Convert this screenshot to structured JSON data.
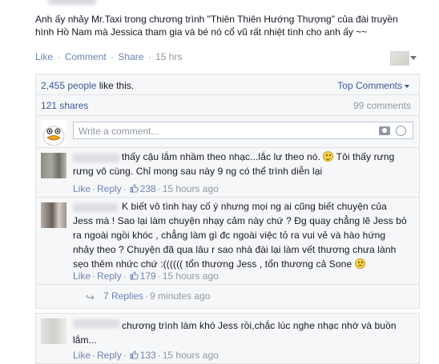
{
  "post": {
    "text_line1": "Anh ấy nhảy Mr.Taxi trong chương trình \"Thiên Thiên Hướng Thượng\" của đài truyền",
    "text_line2": "hình Hồ Nam mà Jessica tham gia và bé nó cổ vũ rất nhiệt tình cho anh ấy ~~",
    "actions": {
      "like": "Like",
      "comment": "Comment",
      "share": "Share",
      "time": "15 hrs"
    }
  },
  "summary": {
    "likes_count": "2,455 people",
    "likes_suffix": "like this.",
    "top_comments": "Top Comments",
    "shares": "121 shares",
    "comments": "99 comments"
  },
  "composer": {
    "placeholder": "Write a comment..."
  },
  "comments": [
    {
      "lines": [
        "thấy cậu lắm nhầm theo nhạc...lắc lư theo nó.",
        "rưng vô cùng. Chỉ mong sau này 9 ng có thể trình diễn lại"
      ],
      "line1_tail": "Tôi thấy rưng",
      "like": "Like",
      "reply": "Reply",
      "likes": "238",
      "time": "15 hours ago"
    },
    {
      "lines": [
        "K biết vô tình hay cố ý nhưng mọi ng ai cũng biết chuyện của",
        "Jess mà ! Sao lại làm chuyện nhạy cảm này chứ ? Đg quay chẳng lẽ Jess bỏ",
        "ra ngoài ngồi khóc , chẳng làm gì đc ngoài việc tỏ ra vui vẻ và hào hứng",
        "nhảy theo ? Chuyện đã qua lâu r sao nhà đài lại làm vết thương chưa lành",
        "sẹo thêm nhức chứ :(((((( tổn thương Jess , tổn thương cả Sone"
      ],
      "like": "Like",
      "reply": "Reply",
      "likes": "179",
      "time": "15 hours ago"
    },
    {
      "lines": [
        "chương trình làm khó Jess rồi,chắc lúc nghe nhạc nhớ và buồn",
        "lắm..."
      ],
      "like": "Like",
      "reply": "Reply",
      "likes": "133",
      "time": "15 hours ago"
    }
  ],
  "replies": {
    "label": "7 Replies",
    "time": "9 minutes ago"
  },
  "colors": {
    "link": "#6d84b4",
    "brand": "#3b5998",
    "muted": "#9197a3",
    "panel": "#f6f7f8"
  }
}
